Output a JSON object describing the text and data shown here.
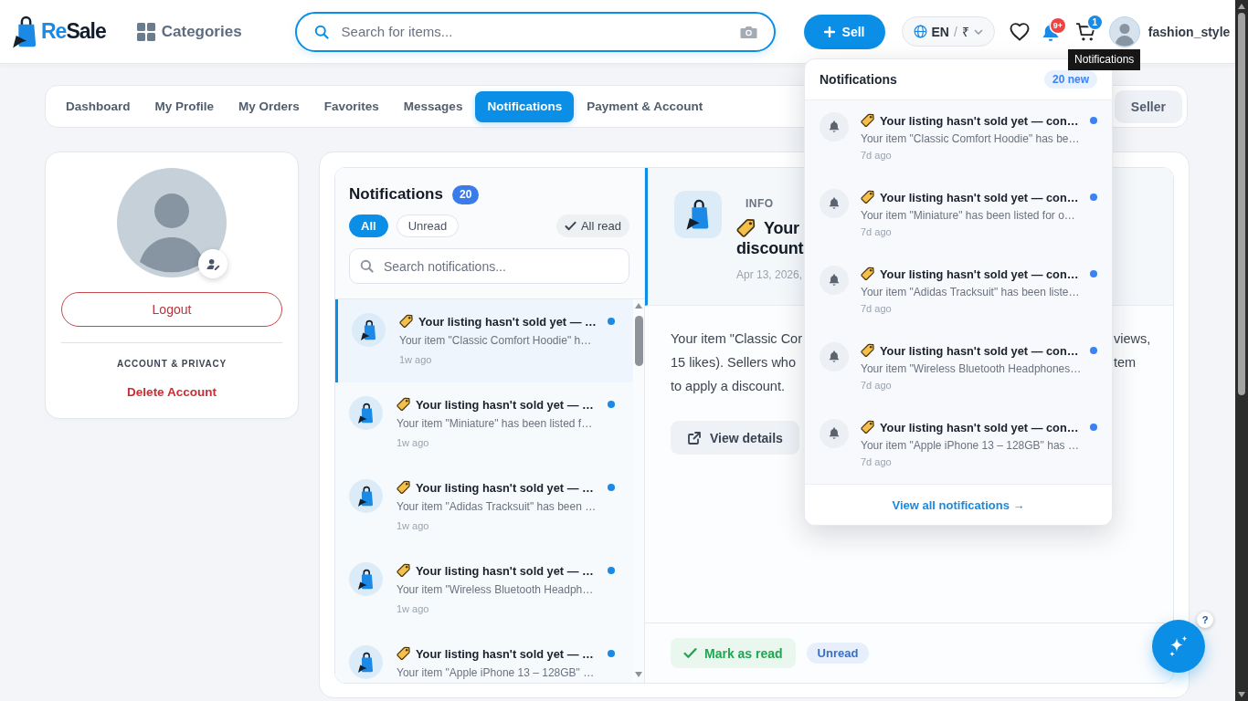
{
  "header": {
    "logo": {
      "parts": [
        "Re",
        "Sale"
      ]
    },
    "categories": "Categories",
    "search": {
      "placeholder": "Search for items..."
    },
    "sell_button": "Sell",
    "locale": {
      "language": "EN",
      "separator": "/",
      "currency": "₹"
    },
    "notification_badge": "9+",
    "cart_badge": "1",
    "username": "fashion_style",
    "tooltip": "Notifications"
  },
  "tabs": [
    {
      "label": "Dashboard",
      "selected": false
    },
    {
      "label": "My Profile",
      "selected": false
    },
    {
      "label": "My Orders",
      "selected": false
    },
    {
      "label": "Favorites",
      "selected": false
    },
    {
      "label": "Messages",
      "selected": false
    },
    {
      "label": "Notifications",
      "selected": true
    },
    {
      "label": "Payment & Account",
      "selected": false
    }
  ],
  "role_switch": [
    {
      "label": "Seller",
      "selected": false
    }
  ],
  "profile_card": {
    "logout": "Logout",
    "section_title": "ACCOUNT & PRIVACY",
    "delete_account": "Delete Account"
  },
  "notifications_panel": {
    "title": "Notifications",
    "count": "20",
    "filters": [
      {
        "label": "All",
        "selected": true
      },
      {
        "label": "Unread",
        "selected": false
      }
    ],
    "mark_all_read": "All read",
    "search": {
      "placeholder": "Search notifications..."
    },
    "items": [
      {
        "title": "Your listing hasn't sold yet — …",
        "summary": "Your item \"Classic Comfort Hoodie\" h…",
        "time": "1w ago",
        "unread": true,
        "selected": true
      },
      {
        "title": "Your listing hasn't sold yet — …",
        "summary": "Your item \"Miniature\" has been listed f…",
        "time": "1w ago",
        "unread": true,
        "selected": false
      },
      {
        "title": "Your listing hasn't sold yet — …",
        "summary": "Your item \"Adidas Tracksuit\" has been …",
        "time": "1w ago",
        "unread": true,
        "selected": false
      },
      {
        "title": "Your listing hasn't sold yet — …",
        "summary": "Your item \"Wireless Bluetooth Headph…",
        "time": "1w ago",
        "unread": true,
        "selected": false
      },
      {
        "title": "Your listing hasn't sold yet — …",
        "summary": "Your item \"Apple iPhone 13 – 128GB\" …",
        "unread": true,
        "selected": false
      }
    ]
  },
  "detail": {
    "type_label": "INFO",
    "title_lines": [
      "Your",
      "discount"
    ],
    "date": "Apr 13, 2026,",
    "message_left": [
      "Your item \"Classic Cor",
      "15 likes). Sellers who",
      "to apply a discount."
    ],
    "message_right": [
      "views,",
      "tem"
    ],
    "view_details": "View details",
    "mark_as_read": "Mark as read",
    "status": "Unread"
  },
  "dropdown": {
    "title": "Notifications",
    "new_count": "20 new",
    "items": [
      {
        "title": "Your listing hasn't sold yet — con…",
        "summary": "Your item \"Classic Comfort Hoodie\" has be…",
        "time": "7d ago",
        "unread": true
      },
      {
        "title": "Your listing hasn't sold yet — con…",
        "summary": "Your item \"Miniature\" has been listed for o…",
        "time": "7d ago",
        "unread": true
      },
      {
        "title": "Your listing hasn't sold yet — con…",
        "summary": "Your item \"Adidas Tracksuit\" has been liste…",
        "time": "7d ago",
        "unread": true
      },
      {
        "title": "Your listing hasn't sold yet — con…",
        "summary": "Your item \"Wireless Bluetooth Headphones…",
        "time": "7d ago",
        "unread": true
      },
      {
        "title": "Your listing hasn't sold yet — con…",
        "summary": "Your item \"Apple iPhone 13 – 128GB\" has …",
        "time": "7d ago",
        "unread": true
      }
    ],
    "footer_link": "View all notifications →"
  },
  "help_badge": "?"
}
